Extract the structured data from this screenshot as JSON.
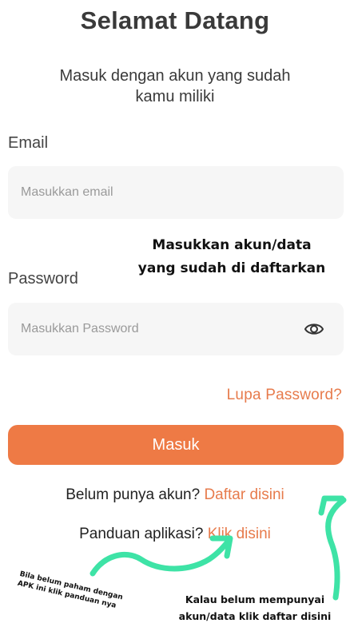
{
  "header": {
    "title": "Selamat Datang",
    "subtitle": "Masuk dengan akun yang sudah kamu miliki"
  },
  "email": {
    "label": "Email",
    "placeholder": "Masukkan email",
    "value": ""
  },
  "password": {
    "label": "Password",
    "placeholder": "Masukkan Password",
    "value": "",
    "toggle_icon": "eye-icon"
  },
  "forgot_password_label": "Lupa Password?",
  "login_button_label": "Masuk",
  "register": {
    "prompt": "Belum punya akun?",
    "link_label": "Daftar disini"
  },
  "guide": {
    "prompt": "Panduan aplikasi?",
    "link_label": "Klik disini"
  },
  "annotations": {
    "credentials_note": [
      "Masukkan akun/data",
      "yang sudah di daftarkan"
    ],
    "guide_note": [
      "Bila belum paham dengan",
      "APK ini klik panduan nya"
    ],
    "register_note": [
      "Kalau belum mempunyai",
      "akun/data klik daftar disini"
    ],
    "arrow_color": "#3ee3a6"
  },
  "colors": {
    "accent": "#ee7a45",
    "link": "#e77b4c",
    "field_bg": "#f6f6f6"
  }
}
